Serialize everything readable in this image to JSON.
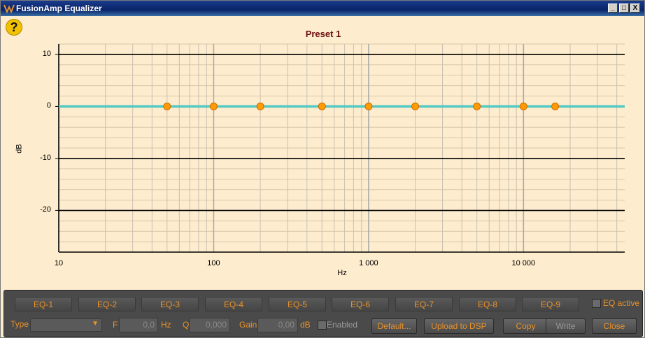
{
  "window": {
    "title": "FusionAmp Equalizer",
    "minimize": "_",
    "maximize": "□",
    "close": "X"
  },
  "help": {
    "label": "?"
  },
  "chart_data": {
    "type": "line",
    "title": "Preset 1",
    "xlabel": "Hz",
    "ylabel": "dB",
    "x_scale": "log",
    "xlim": [
      10,
      45000
    ],
    "ylim": [
      -28,
      12
    ],
    "x_ticks": [
      10,
      100,
      1000,
      10000
    ],
    "x_tick_labels": [
      "10",
      "100",
      "1 000",
      "10 000"
    ],
    "y_ticks": [
      10,
      0,
      -10,
      -20
    ],
    "y_tick_labels": [
      "10",
      "0",
      "-10",
      "-20"
    ],
    "grid": true,
    "line_color": "#4fc9c4",
    "point_color": "#ff9a00",
    "curve": {
      "x": [
        10,
        45000
      ],
      "y": [
        0,
        0
      ]
    },
    "points": {
      "x": [
        50,
        100,
        200,
        500,
        1000,
        2000,
        5000,
        10000,
        16000
      ],
      "y": [
        0,
        0,
        0,
        0,
        0,
        0,
        0,
        0,
        0
      ]
    }
  },
  "controls": {
    "eq_buttons": [
      "EQ-1",
      "EQ-2",
      "EQ-3",
      "EQ-4",
      "EQ-5",
      "EQ-6",
      "EQ-7",
      "EQ-8",
      "EQ-9"
    ],
    "eq_active_label": "EQ active",
    "type_label": "Type",
    "type_value": "",
    "f_label": "F",
    "f_value": "0,0",
    "hz_label": "Hz",
    "q_label": "Q",
    "q_value": "0,000",
    "gain_label": "Gain",
    "gain_value": "0,00",
    "db_label": "dB",
    "enabled_label": "Enabled",
    "default_button": "Default...",
    "upload_button": "Upload to DSP",
    "copy_button": "Copy",
    "write_button": "Write",
    "close_button": "Close"
  },
  "colors": {
    "accent": "#e8922a",
    "panel": "#4a4a4a",
    "chart_bg": "#fdeccd",
    "title": "#6b0f0f"
  }
}
